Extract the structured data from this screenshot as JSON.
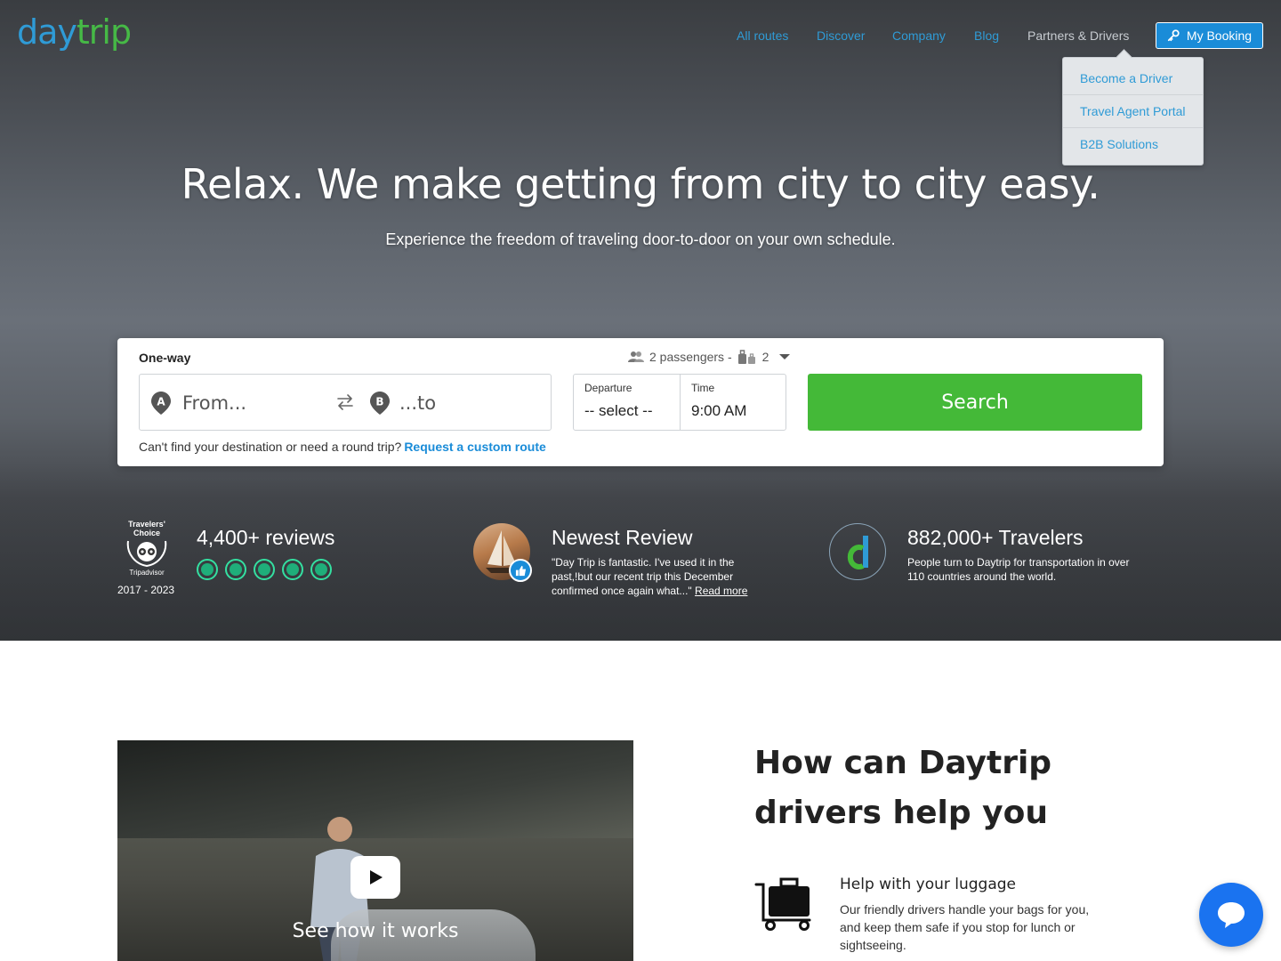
{
  "logo": {
    "part1": "day",
    "part2": "trip"
  },
  "nav": {
    "links": [
      "All routes",
      "Discover",
      "Company",
      "Blog",
      "Partners & Drivers"
    ],
    "my_booking": "My Booking"
  },
  "dropdown": {
    "items": [
      "Become a Driver",
      "Travel Agent Portal",
      "B2B Solutions"
    ]
  },
  "hero": {
    "headline": "Relax. We make getting from city to city easy.",
    "subline": "Experience the freedom of traveling door-to-door on your own schedule."
  },
  "search": {
    "trip_type": "One-way",
    "passengers": "2 passengers -",
    "luggage": "2",
    "from_placeholder": "From...",
    "to_placeholder": "...to",
    "departure_label": "Departure",
    "departure_value": "-- select --",
    "time_label": "Time",
    "time_value": "9:00 AM",
    "button": "Search",
    "custom_text": "Can't find your destination or need a round trip?",
    "custom_link": "Request a custom route"
  },
  "stats": {
    "years": "2017 - 2023",
    "reviews_title": "4,400+ reviews",
    "rating_dots": 5,
    "newest_title": "Newest Review",
    "newest_text": "\"Day Trip is fantastic. I've used it in the past,!but our recent trip this December confirmed once again what...\"",
    "read_more": "Read more",
    "travelers_title": "882,000+ Travelers",
    "travelers_text": "People turn to Daytrip for transportation in over 110 countries around the world."
  },
  "video": {
    "caption": "See how it works"
  },
  "how": {
    "title": "How can Daytrip drivers help you",
    "feature_title": "Help with your luggage",
    "feature_text": "Our friendly drivers handle your bags for you, and keep them safe if you stop for lunch or sightseeing."
  },
  "colors": {
    "brand_blue": "#2f9bd6",
    "brand_green": "#44b938",
    "chat_blue": "#1a73f0"
  }
}
